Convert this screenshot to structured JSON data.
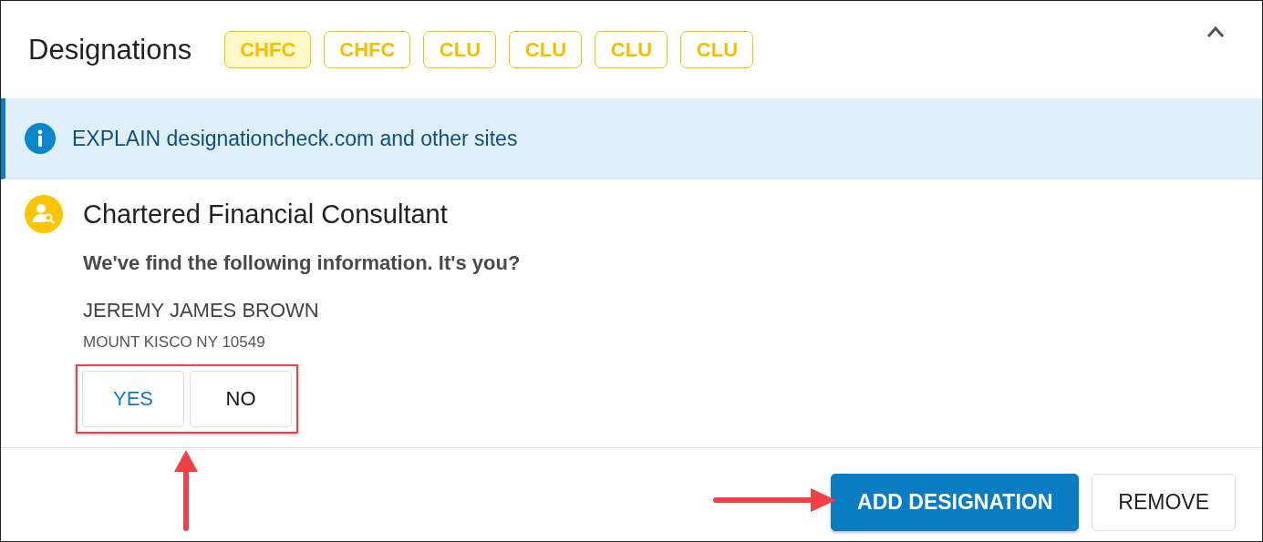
{
  "header": {
    "title": "Designations",
    "chips": [
      {
        "label": "CHFC",
        "selected": true
      },
      {
        "label": "CHFC",
        "selected": false
      },
      {
        "label": "CLU",
        "selected": false
      },
      {
        "label": "CLU",
        "selected": false
      },
      {
        "label": "CLU",
        "selected": false
      },
      {
        "label": "CLU",
        "selected": false
      }
    ],
    "expanded": true
  },
  "info_banner": {
    "text": "EXPLAIN designationcheck.com and other sites"
  },
  "match": {
    "title": "Chartered Financial Consultant",
    "question": "We've find the following information. It's you?",
    "name": "JEREMY JAMES BROWN",
    "address": "MOUNT KISCO NY 10549",
    "choices": [
      {
        "label": "YES",
        "selected": true
      },
      {
        "label": "NO",
        "selected": false
      }
    ]
  },
  "actions": [
    {
      "label": "ADD DESIGNATION",
      "kind": "primary"
    },
    {
      "label": "REMOVE",
      "kind": "secondary"
    }
  ]
}
